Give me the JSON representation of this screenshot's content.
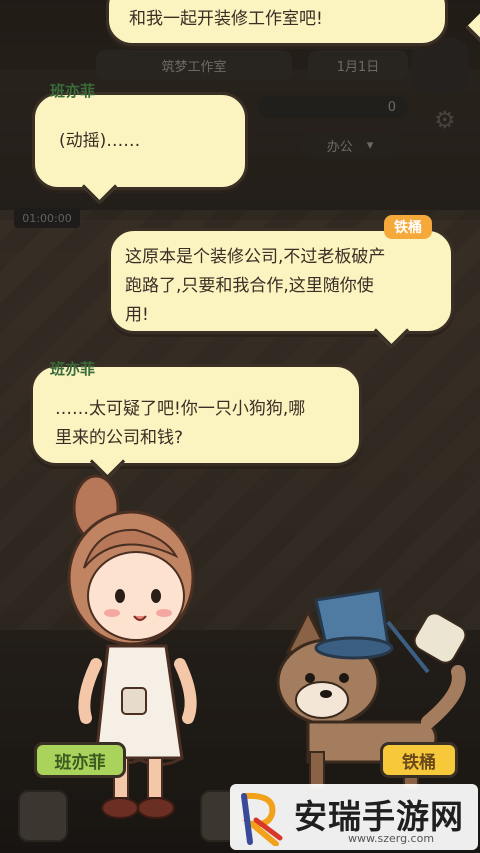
{
  "dialogs": [
    {
      "speaker": "",
      "lines": [
        "和我一起开装修工作室吧!"
      ]
    },
    {
      "speaker": "班亦菲",
      "lines": [
        "(动摇)……"
      ]
    },
    {
      "speaker": "铁桶",
      "lines": [
        "这原本是个装修公司,不过老板破产",
        "跑路了,只要和我合作,这里随你使",
        "用!"
      ]
    },
    {
      "speaker": "班亦菲",
      "lines": [
        "……太可疑了吧!你一只小狗狗,哪",
        "里来的公司和钱?"
      ]
    }
  ],
  "hud": {
    "studio_name": "筑梦工作室",
    "date": "1月1日",
    "timer": "01:00:00",
    "counter": "0",
    "filter": "办公"
  },
  "characters": {
    "girl": "班亦菲",
    "dog": "铁桶"
  },
  "watermark": {
    "name": "安瑞手游网",
    "url": "www.szerg.com"
  }
}
